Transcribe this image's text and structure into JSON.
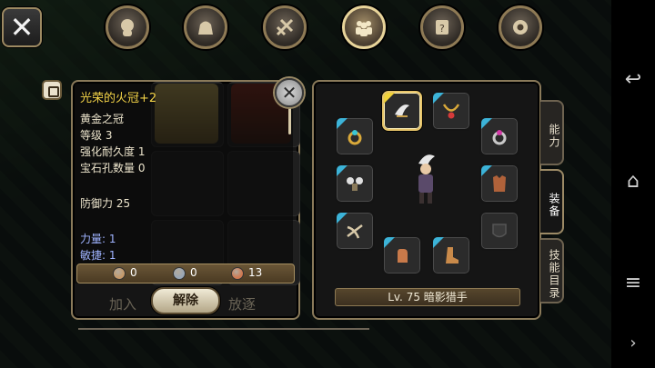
{
  "top_menu": {
    "close_label": "✕",
    "icons": [
      {
        "name": "head-icon",
        "active": false
      },
      {
        "name": "bag-icon",
        "active": false
      },
      {
        "name": "skill-icon",
        "active": false
      },
      {
        "name": "party-icon",
        "active": true
      },
      {
        "name": "quest-scroll-icon",
        "active": false
      },
      {
        "name": "settings-gear-icon",
        "active": false
      }
    ]
  },
  "item_tooltip": {
    "title": "光荣的火冠+2",
    "lines": [
      "黄金之冠",
      "等级 3",
      "强化耐久度 1",
      "宝石孔数量 0"
    ],
    "defense": "防御力 25",
    "stats": [
      "力量: 1",
      "敏捷: 1"
    ],
    "close_label": "✕"
  },
  "currency": {
    "values": [
      "0",
      "0",
      "13"
    ],
    "colors": [
      "#c79a6a",
      "#9aa7b6",
      "#d07a52"
    ]
  },
  "buttons": {
    "join_label": "加入",
    "remove_label": "解除",
    "dismiss_label": "放逐"
  },
  "equipment": {
    "level_text": "Lv. 75 暗影猎手",
    "slots": [
      {
        "name": "helmet-slot",
        "icon": "feather-helmet-icon",
        "tri": "gold",
        "selected": true
      },
      {
        "name": "necklace-slot",
        "icon": "necklace-icon",
        "tri": "blue"
      },
      {
        "name": "ring-left-slot",
        "icon": "ring-icon",
        "tri": "blue"
      },
      {
        "name": "ring-right-slot",
        "icon": "ring-icon",
        "tri": "blue"
      },
      {
        "name": "shoulder-slot",
        "icon": "shoulder-armor-icon",
        "tri": "blue"
      },
      {
        "name": "body-armor-slot",
        "icon": "body-armor-icon",
        "tri": "blue"
      },
      {
        "name": "weapon-slot",
        "icon": "crossbow-icon",
        "tri": "blue"
      },
      {
        "name": "offhand-slot",
        "icon": "empty-slot-icon",
        "tri": "none"
      },
      {
        "name": "gloves-slot",
        "icon": "gloves-icon",
        "tri": "blue"
      },
      {
        "name": "boots-slot",
        "icon": "boots-icon",
        "tri": "blue"
      }
    ]
  },
  "side_tabs": [
    "能力",
    "装备",
    "技能目录"
  ],
  "android_nav": [
    "↩",
    "⌂",
    "≡",
    "›"
  ]
}
